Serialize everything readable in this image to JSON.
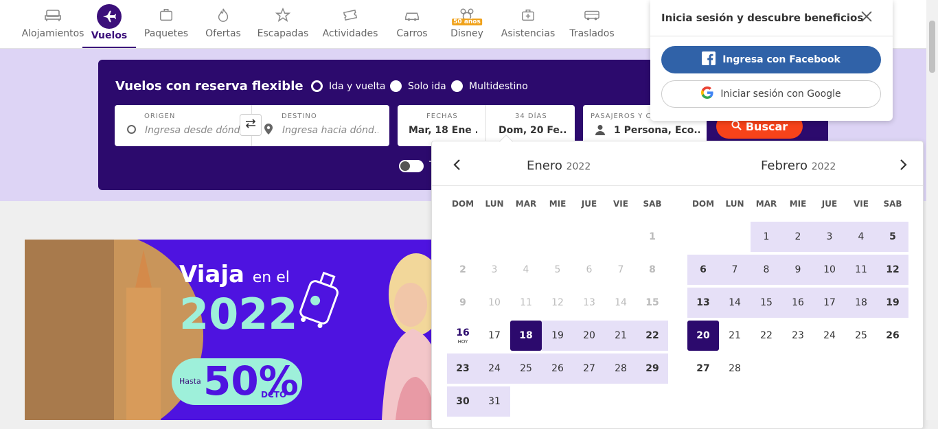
{
  "nav": {
    "items": [
      {
        "label": "Alojamientos",
        "icon": "bed-icon"
      },
      {
        "label": "Vuelos",
        "icon": "plane-icon"
      },
      {
        "label": "Paquetes",
        "icon": "suitcase-icon"
      },
      {
        "label": "Ofertas",
        "icon": "flame-icon"
      },
      {
        "label": "Escapadas",
        "icon": "star-icon"
      },
      {
        "label": "Actividades",
        "icon": "ticket-icon"
      },
      {
        "label": "Carros",
        "icon": "car-icon"
      },
      {
        "label": "Disney",
        "icon": "mickey-icon",
        "badge": "50 años"
      },
      {
        "label": "Asistencias",
        "icon": "medical-kit-icon"
      },
      {
        "label": "Traslados",
        "icon": "bus-icon"
      }
    ],
    "active": "Vuelos"
  },
  "search": {
    "title": "Vuelos con reserva flexible",
    "trip_types": [
      "Ida y vuelta",
      "Solo ida",
      "Multidestino"
    ],
    "selected_trip_type": "Ida y vuelta",
    "origin_label": "ORIGEN",
    "origin_placeholder": "Ingresa desde dónd...",
    "dest_label": "DESTINO",
    "dest_placeholder": "Ingresa hacia dónd...",
    "dates_label": "FECHAS",
    "date_from": "Mar, 18 Ene ...",
    "days_label": "34 DÍAS",
    "date_to": "Dom, 20 Fe...",
    "pax_label": "PASAJEROS Y C...",
    "pax_value": "1 Persona, Eco...",
    "button": "Buscar",
    "toggle_label": "T"
  },
  "calendar": {
    "weekdays": [
      "DOM",
      "LUN",
      "MAR",
      "MIE",
      "JUE",
      "VIE",
      "SAB"
    ],
    "today_label": "HOY",
    "months": [
      {
        "name": "Enero",
        "year": "2022"
      },
      {
        "name": "Febrero",
        "year": "2022"
      }
    ]
  },
  "banner": {
    "line1_big": "Viaja",
    "line1_small": "en el",
    "year": "2022",
    "hasta": "Hasta",
    "percent": "50%",
    "dcto": "DCTO"
  },
  "login": {
    "title": "Inicia sesión y descubre beneficios",
    "facebook": "Ingresa con Facebook",
    "google": "Iniciar sesión con Google"
  },
  "colors": {
    "primary": "#2c0a6d",
    "accent": "#f7431a",
    "range": "#e6e0f7",
    "hero_bg": "#ddd4f5",
    "facebook": "#3062a8"
  }
}
